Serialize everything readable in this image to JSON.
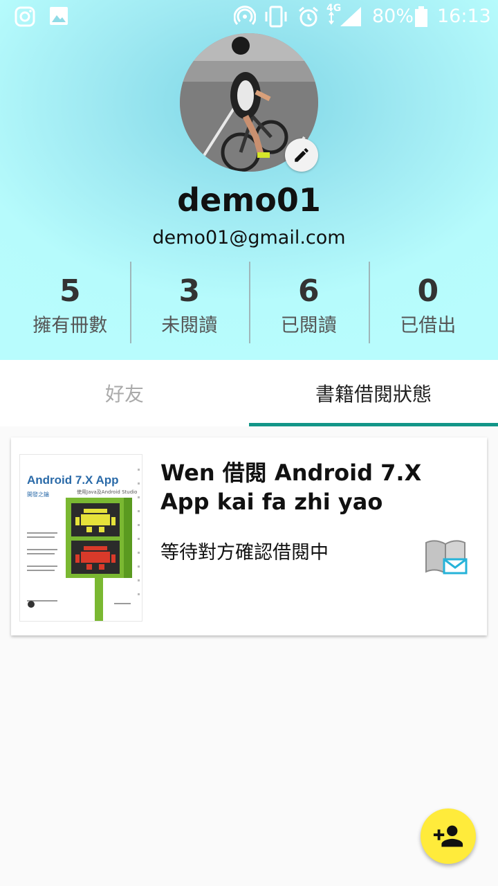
{
  "status_bar": {
    "battery": "80%",
    "time": "16:13",
    "network": "4G",
    "icons": [
      "instagram-icon",
      "image-icon",
      "hotspot-icon",
      "vibrate-icon",
      "alarm-icon",
      "signal-icon",
      "battery-icon"
    ]
  },
  "profile": {
    "username": "demo01",
    "email": "demo01@gmail.com"
  },
  "stats": [
    {
      "value": "5",
      "label": "擁有冊數"
    },
    {
      "value": "3",
      "label": "未閱讀"
    },
    {
      "value": "6",
      "label": "已閱讀"
    },
    {
      "value": "0",
      "label": "已借出"
    }
  ],
  "tabs": [
    {
      "label": "好友",
      "active": false
    },
    {
      "label": "書籍借閱狀態",
      "active": true
    }
  ],
  "cards": [
    {
      "title": "Wen 借閱 Android 7.X App kai fa zhi yao",
      "status": "等待對方確認借閱中",
      "cover": {
        "title": "Android 7.X App",
        "subtitle": "開發之鑰",
        "tagline": "使用Java及Android Studio"
      }
    }
  ],
  "colors": {
    "tab_indicator": "#129688",
    "fab": "#ffeb3b",
    "header_light": "#b8fcfd"
  }
}
